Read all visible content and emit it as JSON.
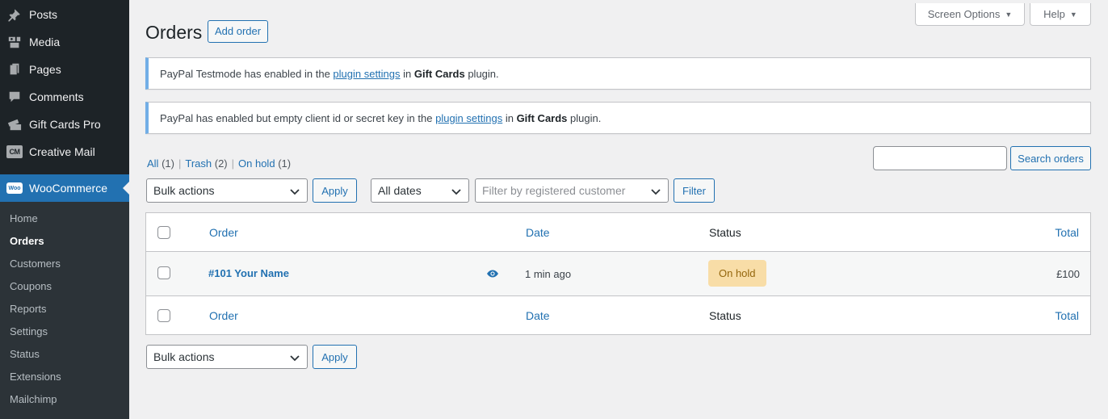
{
  "sidebar": {
    "items": [
      {
        "label": "Posts",
        "icon": "pin-icon"
      },
      {
        "label": "Media",
        "icon": "media-icon"
      },
      {
        "label": "Pages",
        "icon": "pages-icon"
      },
      {
        "label": "Comments",
        "icon": "comment-icon"
      },
      {
        "label": "Gift Cards Pro",
        "icon": "gift-cards-icon"
      },
      {
        "label": "Creative Mail",
        "icon": "cm-icon",
        "badge": "CM"
      }
    ],
    "active": {
      "label": "WooCommerce",
      "badge": "Woo"
    },
    "submenu": [
      "Home",
      "Orders",
      "Customers",
      "Coupons",
      "Reports",
      "Settings",
      "Status",
      "Extensions",
      "Mailchimp"
    ],
    "current_submenu": "Orders"
  },
  "header": {
    "screen_options": "Screen Options",
    "help": "Help",
    "title": "Orders",
    "add_order": "Add order"
  },
  "notices": [
    {
      "prefix": "PayPal Testmode has enabled in the ",
      "link": "plugin settings",
      "middle": " in ",
      "bold": "Gift Cards",
      "suffix": " plugin."
    },
    {
      "prefix": "PayPal has enabled but empty client id or secret key in the ",
      "link": "plugin settings",
      "middle": " in ",
      "bold": "Gift Cards",
      "suffix": " plugin."
    }
  ],
  "views": {
    "all": "All",
    "all_count": "(1)",
    "trash": "Trash",
    "trash_count": "(2)",
    "on_hold": "On hold",
    "on_hold_count": "(1)",
    "separator": "|"
  },
  "search": {
    "value": "",
    "button": "Search orders"
  },
  "filters": {
    "bulk_actions": "Bulk actions",
    "apply": "Apply",
    "dates": "All dates",
    "customer_placeholder": "Filter by registered customer",
    "filter": "Filter"
  },
  "table": {
    "columns": {
      "order": "Order",
      "date": "Date",
      "status": "Status",
      "total": "Total"
    },
    "rows": [
      {
        "order": "#101 Your Name",
        "date": "1 min ago",
        "status": "On hold",
        "total": "£100"
      }
    ]
  },
  "bottom": {
    "bulk_actions": "Bulk actions",
    "apply": "Apply"
  },
  "colors": {
    "accent": "#2271b1",
    "sidebar": "#1d2327",
    "submenu": "#2c3338",
    "on_hold_bg": "#f8dda7",
    "on_hold_text": "#94660c"
  }
}
